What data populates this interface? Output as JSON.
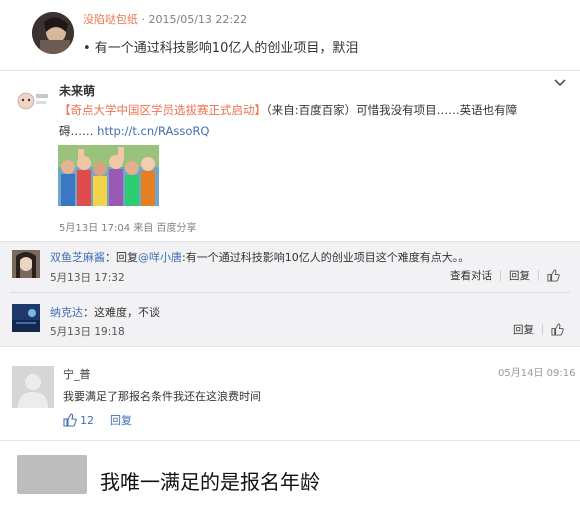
{
  "post1": {
    "user": "没陷哒包纸",
    "date": "· 2015/05/13 22:22",
    "text": "• 有一个通过科技影响10亿人的创业项目，默泪"
  },
  "post2": {
    "user": "未来萌",
    "title_link": "【奇点大学中国区学员选拔赛正式启动】",
    "title_tail": "（来自:百度百家）可惜我没有项目……英语也有障",
    "line2_text": "碍……",
    "url": "http://t.cn/RAssoRQ",
    "meta": "5月13日 17:04 来自 百度分享"
  },
  "reply1": {
    "user": "双鱼芝麻酱",
    "prefix": "：回复",
    "mention": "@咩小唐",
    "text": ":有一个通过科技影响10亿人的创业项目这个难度有点大。。",
    "time": "5月13日 17:32",
    "actions": [
      "查看对话",
      "回复"
    ]
  },
  "reply2": {
    "user": "纳克达",
    "text": "：这难度，不谈",
    "time": "5月13日 19:18",
    "actions": [
      "回复"
    ]
  },
  "comment": {
    "user": "宁_普",
    "date": "05月14日 09:16",
    "text": "我要满足了那报名条件我还在这浪费时间",
    "likes": "12",
    "reply": "回复"
  },
  "caption": {
    "text": "我唯一满足的是报名年龄"
  },
  "colors": {
    "accent_orange": "#eb7350",
    "link_blue": "#3f6fb3",
    "reply_bg": "#f2f2f5"
  },
  "icons": [
    "chevron-down-icon",
    "thumbs-up-icon"
  ]
}
